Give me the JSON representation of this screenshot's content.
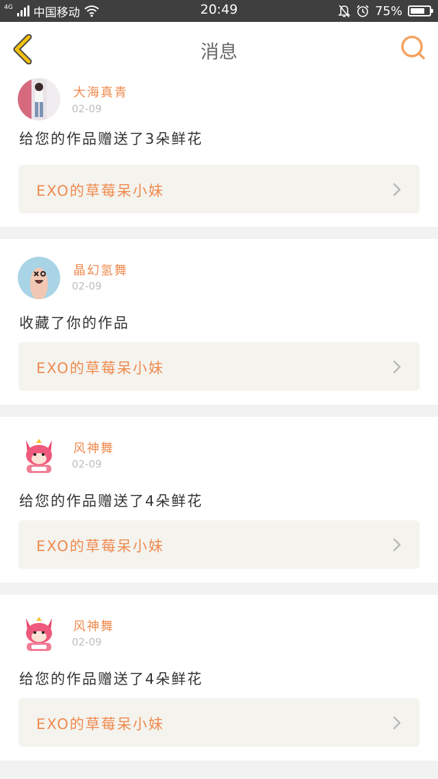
{
  "status_bar": {
    "network": "4G",
    "carrier": "中国移动",
    "time": "20:49",
    "battery_percent": "75%",
    "battery_level": 0.75,
    "icons": [
      "signal-icon",
      "wifi-icon",
      "mute-bell-icon",
      "alarm-icon",
      "battery-icon"
    ]
  },
  "header": {
    "title": "消息",
    "back_icon": "chevron-left-icon",
    "search_icon": "search-icon",
    "accent_color": "#ef8a4e",
    "back_color": "#f2c10e"
  },
  "notifications": [
    {
      "username": "大海真青",
      "date": "02-09",
      "action": "给您的作品赠送了3朵鲜花",
      "work_title": "EXO的草莓呆小妹"
    },
    {
      "username": "晶幻氢舞",
      "date": "02-09",
      "action": "收藏了你的作品",
      "work_title": "EXO的草莓呆小妹"
    },
    {
      "username": "风神舞",
      "date": "02-09",
      "action": "给您的作品赠送了4朵鲜花",
      "work_title": "EXO的草莓呆小妹"
    },
    {
      "username": "风神舞",
      "date": "02-09",
      "action": "给您的作品赠送了4朵鲜花",
      "work_title": "EXO的草莓呆小妹"
    }
  ]
}
